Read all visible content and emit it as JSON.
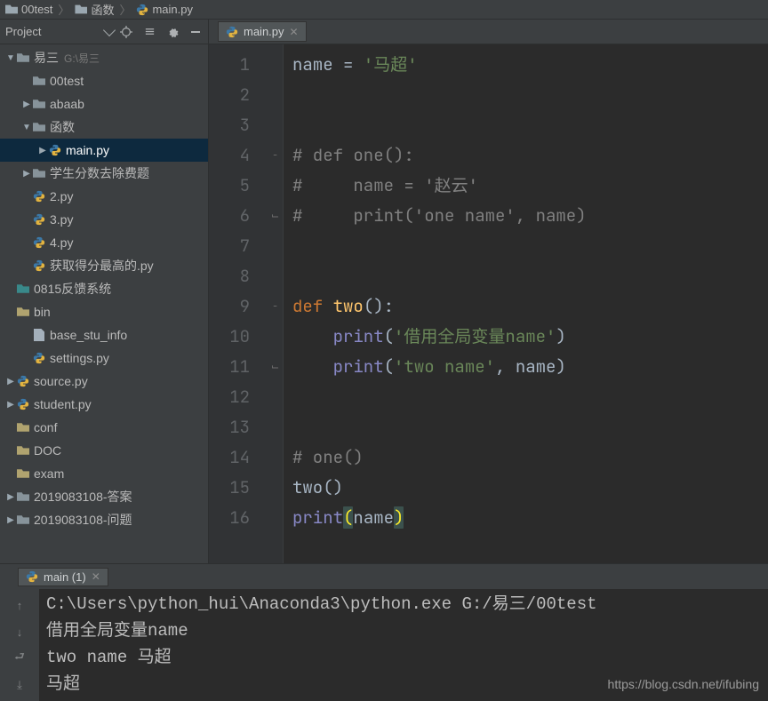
{
  "breadcrumb": {
    "items": [
      {
        "icon": "folder",
        "label": "00test"
      },
      {
        "icon": "folder",
        "label": "函数"
      },
      {
        "icon": "py",
        "label": "main.py"
      }
    ]
  },
  "project": {
    "header_label": "Project",
    "root": {
      "label": "易三",
      "hint": "G:\\易三"
    },
    "items": [
      {
        "indent": 0,
        "arrow": "down",
        "icon": "folder-dark",
        "label": "易三",
        "hint": "G:\\易三"
      },
      {
        "indent": 1,
        "arrow": "none",
        "icon": "folder-dark",
        "label": "00test"
      },
      {
        "indent": 1,
        "arrow": "right",
        "icon": "folder-dark",
        "label": "abaab"
      },
      {
        "indent": 1,
        "arrow": "down",
        "icon": "folder-dark",
        "label": "函数"
      },
      {
        "indent": 2,
        "arrow": "right",
        "icon": "py",
        "label": "main.py",
        "selected": true
      },
      {
        "indent": 1,
        "arrow": "right",
        "icon": "folder-dark",
        "label": "学生分数去除费题"
      },
      {
        "indent": 1,
        "arrow": "none",
        "icon": "py",
        "label": "2.py"
      },
      {
        "indent": 1,
        "arrow": "none",
        "icon": "py",
        "label": "3.py"
      },
      {
        "indent": 1,
        "arrow": "none",
        "icon": "py",
        "label": "4.py"
      },
      {
        "indent": 1,
        "arrow": "none",
        "icon": "py",
        "label": "获取得分最高的.py"
      },
      {
        "indent": 0,
        "arrow": "none",
        "icon": "folder-teal",
        "label": "0815反馈系统"
      },
      {
        "indent": 0,
        "arrow": "none",
        "icon": "folder-plain",
        "label": "bin"
      },
      {
        "indent": 1,
        "arrow": "none",
        "icon": "file",
        "label": "base_stu_info"
      },
      {
        "indent": 1,
        "arrow": "none",
        "icon": "py",
        "label": "settings.py"
      },
      {
        "indent": 0,
        "arrow": "right",
        "icon": "py",
        "label": "source.py"
      },
      {
        "indent": 0,
        "arrow": "right",
        "icon": "py",
        "label": "student.py"
      },
      {
        "indent": 0,
        "arrow": "none",
        "icon": "folder-plain",
        "label": "conf"
      },
      {
        "indent": 0,
        "arrow": "none",
        "icon": "folder-plain",
        "label": "DOC"
      },
      {
        "indent": 0,
        "arrow": "none",
        "icon": "folder-plain",
        "label": "exam"
      },
      {
        "indent": 0,
        "arrow": "right",
        "icon": "folder-dark",
        "label": "2019083108-答案"
      },
      {
        "indent": 0,
        "arrow": "right",
        "icon": "folder-dark",
        "label": "2019083108-问题"
      }
    ]
  },
  "editor": {
    "tab_label": "main.py",
    "lines": [
      {
        "n": "1",
        "html": "<span class='id'>name = </span><span class='str'>'马超'</span>"
      },
      {
        "n": "2",
        "html": ""
      },
      {
        "n": "3",
        "html": ""
      },
      {
        "n": "4",
        "html": "<span class='cmt'># def one():</span>",
        "fold": "−"
      },
      {
        "n": "5",
        "html": "<span class='cmt'>#     name = '赵云'</span>"
      },
      {
        "n": "6",
        "html": "<span class='cmt'>#     print('one name', name)</span>",
        "fold": "⌙"
      },
      {
        "n": "7",
        "html": ""
      },
      {
        "n": "8",
        "html": ""
      },
      {
        "n": "9",
        "html": "<span class='kw'>def </span><span class='fn'>two</span><span class='id'>():</span>",
        "fold": "−"
      },
      {
        "n": "10",
        "html": "    <span class='builtin'>print</span><span class='id'>(</span><span class='str'>'借用全局变量name'</span><span class='id'>)</span>"
      },
      {
        "n": "11",
        "html": "    <span class='builtin'>print</span><span class='id'>(</span><span class='str'>'two name'</span><span class='id'>, name)</span>",
        "fold": "⌙"
      },
      {
        "n": "12",
        "html": ""
      },
      {
        "n": "13",
        "html": ""
      },
      {
        "n": "14",
        "html": "<span class='cmt'># one()</span>"
      },
      {
        "n": "15",
        "html": "<span class='id'>two()</span>"
      },
      {
        "n": "16",
        "html": "<span class='builtin'>print</span><span class='hl-paren'>(</span><span class='id'>name</span><span class='hl-paren'>)</span>"
      }
    ]
  },
  "run": {
    "tab_label": "main (1)",
    "output": [
      "C:\\Users\\python_hui\\Anaconda3\\python.exe G:/易三/00test",
      "借用全局变量name",
      "two name 马超",
      "马超"
    ],
    "watermark": "https://blog.csdn.net/ifubing"
  }
}
